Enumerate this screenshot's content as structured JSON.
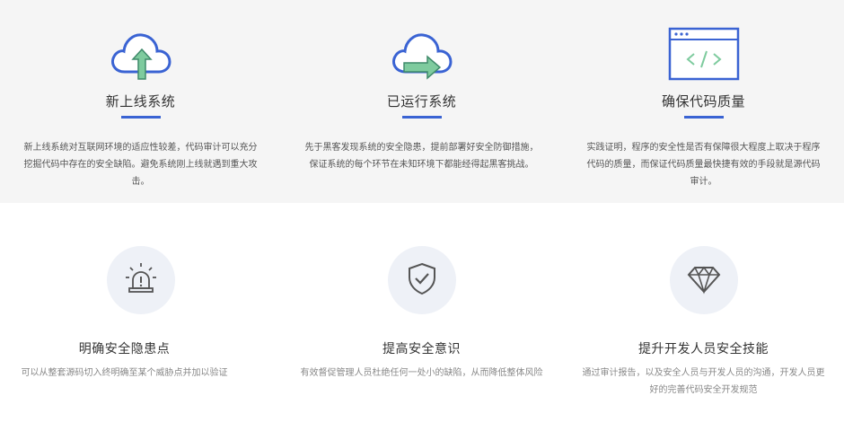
{
  "features_top": [
    {
      "icon": "cloud-upload-icon",
      "title": "新上线系统",
      "desc": "新上线系统对互联网环境的适应性较差，代码审计可以充分挖掘代码中存在的安全缺陷。避免系统刚上线就遇到重大攻击。"
    },
    {
      "icon": "cloud-arrow-right-icon",
      "title": "已运行系统",
      "desc": "先于黑客发现系统的安全隐患，提前部署好安全防御措施，保证系统的每个环节在未知环境下都能经得起黑客挑战。"
    },
    {
      "icon": "code-window-icon",
      "title": "确保代码质量",
      "desc": "实践证明，程序的安全性是否有保障很大程度上取决于程序代码的质量，而保证代码质量最快捷有效的手段就是源代码审计。"
    }
  ],
  "features_bottom": [
    {
      "icon": "alarm-light-icon",
      "title": "明确安全隐患点",
      "desc": "可以从整套源码切入终明确至某个威胁点并加以验证"
    },
    {
      "icon": "shield-check-icon",
      "title": "提高安全意识",
      "desc": "有效督促管理人员杜绝任何一处小的缺陷，从而降低整体风险"
    },
    {
      "icon": "diamond-icon",
      "title": "提升开发人员安全技能",
      "desc": "通过审计报告，以及安全人员与开发人员的沟通，开发人员更好的完善代码安全开发规范"
    }
  ],
  "colors": {
    "accent_blue": "#3a63d3",
    "icon_green": "#7ecb9e",
    "top_bg": "#f5f5f5",
    "circle_bg": "#eef1f7"
  }
}
